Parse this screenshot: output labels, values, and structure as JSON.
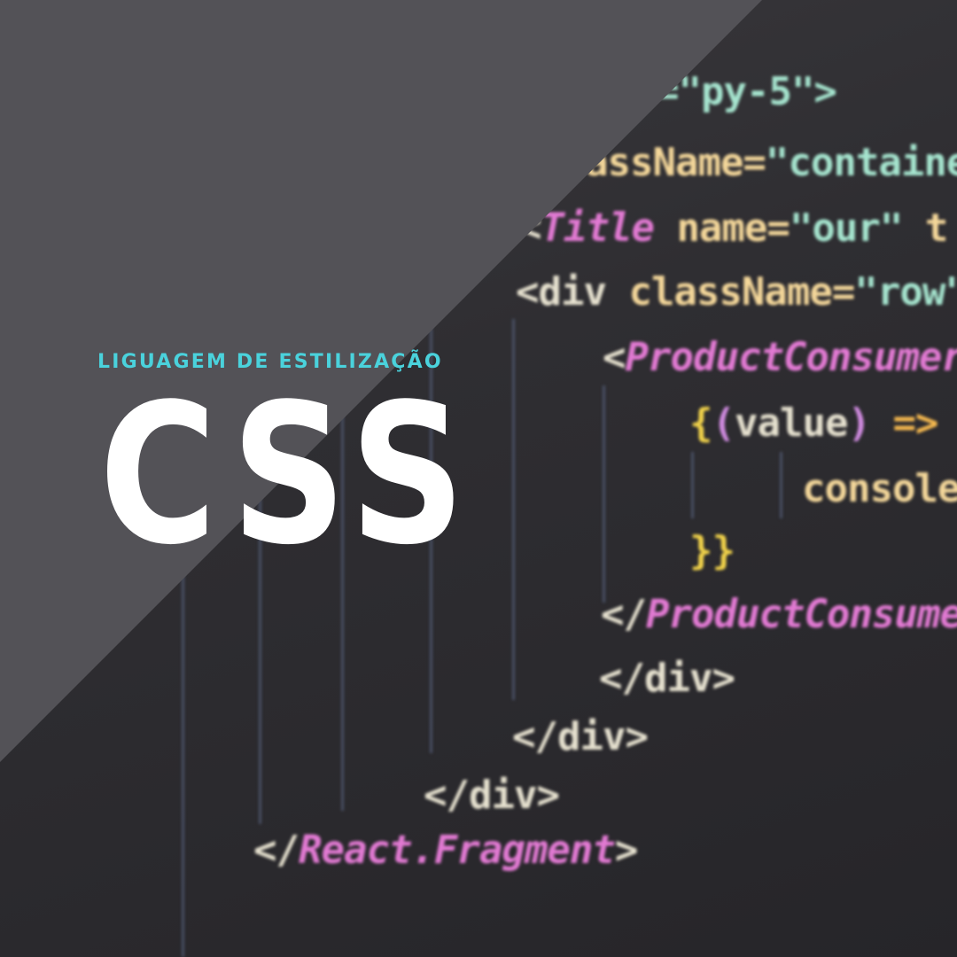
{
  "subtitle": "LIGUAGEM DE ESTILIZAÇÃO",
  "title": "CSS",
  "colors": {
    "overlay": "#535257",
    "subtitle": "#4ad2dc",
    "title": "#ffffff"
  },
  "code_lines": [
    [
      {
        "t": "=\"py-5\">",
        "c": "tok-str"
      }
    ],
    [
      {
        "t": "assName=",
        "c": "tok-attr"
      },
      {
        "t": "\"containe",
        "c": "tok-str"
      }
    ],
    [
      {
        "t": "<",
        "c": "tok-punc"
      },
      {
        "t": "Title",
        "c": "tok-comp"
      },
      {
        "t": " name=",
        "c": "tok-attr"
      },
      {
        "t": "\"our\"",
        "c": "tok-str"
      },
      {
        "t": " t",
        "c": "tok-attr"
      }
    ],
    [
      {
        "t": "<div ",
        "c": "tok-tag"
      },
      {
        "t": "className=",
        "c": "tok-attr"
      },
      {
        "t": "\"row\"",
        "c": "tok-str"
      }
    ],
    [
      {
        "t": "<",
        "c": "tok-punc"
      },
      {
        "t": "ProductConsumer",
        "c": "tok-comp"
      }
    ],
    [
      {
        "t": "{",
        "c": "tok-brace"
      },
      {
        "t": "(",
        "c": "tok-paren"
      },
      {
        "t": "value",
        "c": "tok-tag"
      },
      {
        "t": ")",
        "c": "tok-paren"
      },
      {
        "t": " =>",
        "c": "tok-arrow"
      }
    ],
    [
      {
        "t": "console",
        "c": "tok-attr"
      }
    ],
    [
      {
        "t": "}}",
        "c": "tok-brace"
      }
    ],
    [
      {
        "t": "</",
        "c": "tok-punc"
      },
      {
        "t": "ProductConsume",
        "c": "tok-comp"
      }
    ],
    [
      {
        "t": "</div>",
        "c": "tok-tag"
      }
    ],
    [
      {
        "t": "</div>",
        "c": "tok-tag"
      }
    ],
    [
      {
        "t": "</div>",
        "c": "tok-tag"
      }
    ],
    [
      {
        "t": "</",
        "c": "tok-punc"
      },
      {
        "t": "React.Fragment",
        "c": "tok-comp"
      },
      {
        "t": ">",
        "c": "tok-punc"
      }
    ]
  ]
}
